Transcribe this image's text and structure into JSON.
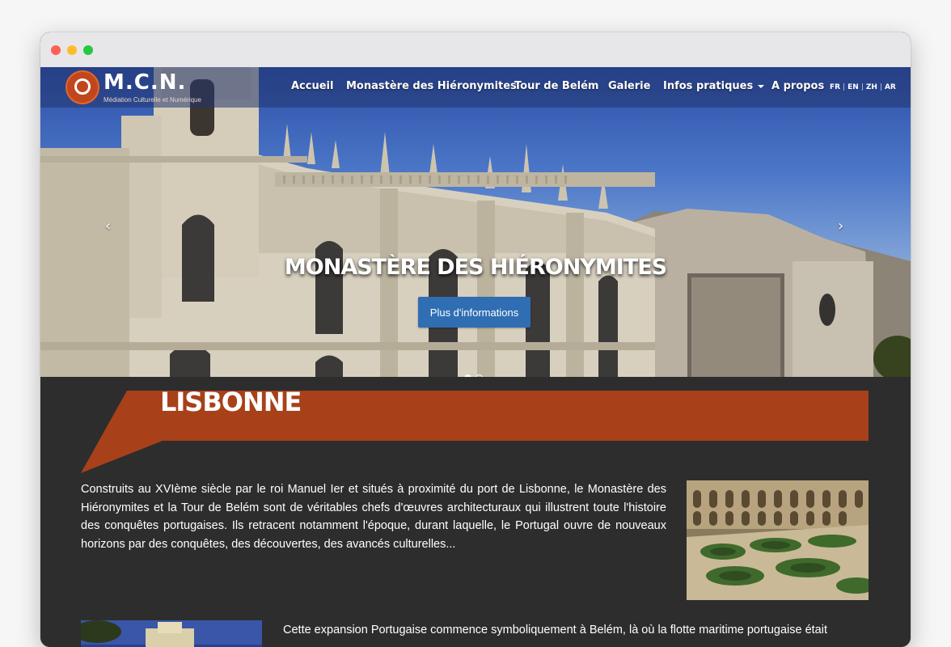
{
  "window": {
    "controls": [
      "close",
      "minimize",
      "maximize"
    ]
  },
  "logo": {
    "title": "M.C.N.",
    "subtitle": "Médiation Culturelle et Numérique"
  },
  "nav": {
    "items": [
      {
        "label": "Accueil"
      },
      {
        "label": "Monastère des Hiéronymites"
      },
      {
        "label": "Tour de Belém"
      },
      {
        "label": "Galerie"
      },
      {
        "label": "Infos pratiques",
        "dropdown": true
      },
      {
        "label": "A propos"
      }
    ],
    "languages": [
      "FR",
      "EN",
      "ZH",
      "AR"
    ],
    "separator": "|"
  },
  "carousel": {
    "caption": "MONASTÈRE DES HIÉRONYMITES",
    "button_label": "Plus d'informations",
    "prev_symbol": "‹",
    "next_symbol": "›",
    "slide_count": 2,
    "active_slide": 1
  },
  "section": {
    "title": "LISBONNE",
    "accent_color": "#a8401a",
    "paragraph1": "Construits au XVIème siècle par le roi Manuel Ier et situés à proximité du port de Lisbonne, le Monastère des Hiéronymites et la Tour de Belém sont de véritables chefs d'œuvres architecturaux qui illustrent toute l'histoire des conquêtes portugaises. Ils retracent notamment l'époque, durant laquelle, le Portugal ouvre de nouveaux horizons par des conquêtes, des découvertes, des avancés culturelles...",
    "paragraph2": "Cette expansion Portugaise commence symboliquement à Belém, là où la flotte maritime portugaise était"
  },
  "colors": {
    "page_background": "#2d2d2d",
    "navbar_overlay": "#23346e",
    "button_blue": "#2f6eb3",
    "logo_orange": "#c2461c"
  }
}
